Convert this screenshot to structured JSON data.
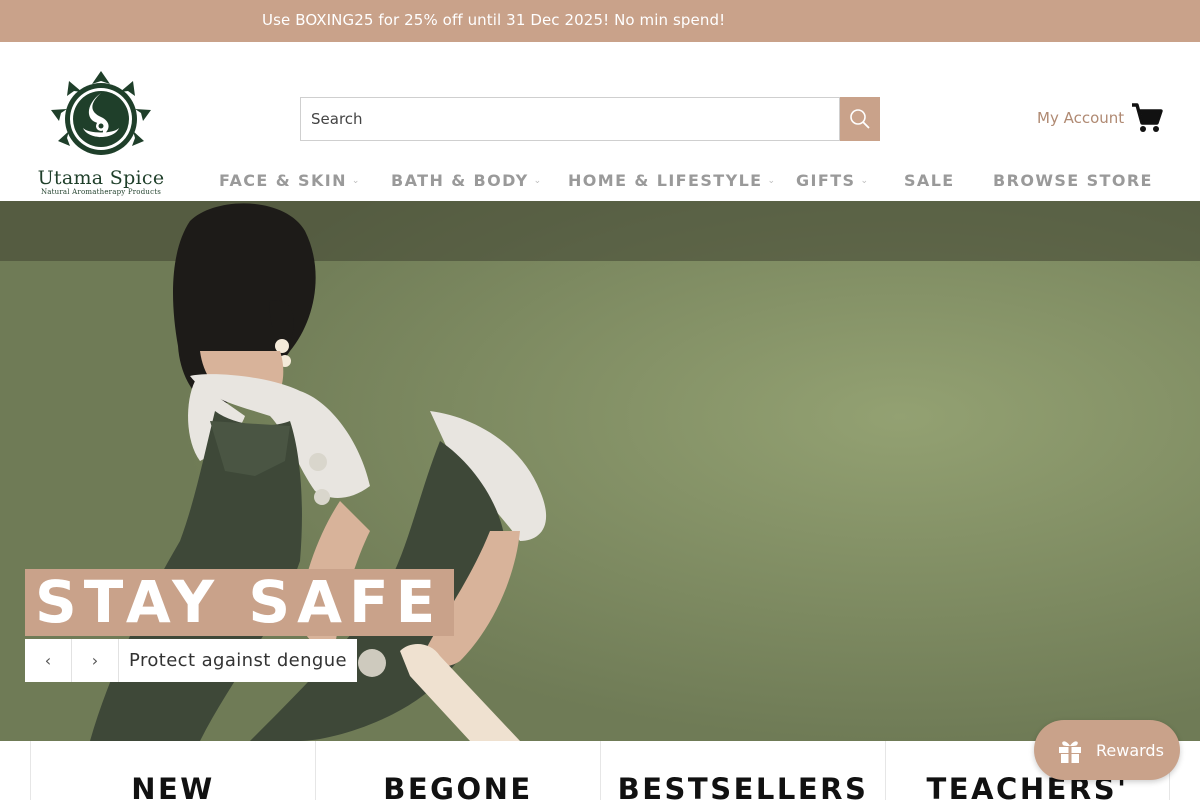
{
  "announcement": {
    "text": "Use BOXING25 for 25% off until 31 Dec 2025! No min spend!"
  },
  "brand": {
    "name": "Utama Spice",
    "tagline": "Natural Aromatherapy Products",
    "accent_color": "#c9a28a",
    "logo_color": "#1f3f2a"
  },
  "search": {
    "placeholder": "Search",
    "button_icon": "search-icon"
  },
  "account": {
    "label": "My Account",
    "cart_icon": "cart-icon"
  },
  "nav": {
    "items": [
      {
        "label": "FACE & SKIN",
        "has_dropdown": true
      },
      {
        "label": "BATH & BODY",
        "has_dropdown": true
      },
      {
        "label": "HOME & LIFESTYLE",
        "has_dropdown": true
      },
      {
        "label": "GIFTS",
        "has_dropdown": true
      },
      {
        "label": "SALE",
        "has_dropdown": false
      },
      {
        "label": "BROWSE STORE",
        "has_dropdown": false
      }
    ]
  },
  "hero": {
    "title": "STAY SAFE",
    "subtitle": "Protect against dengue",
    "prev_icon": "chevron-left-icon",
    "next_icon": "chevron-right-icon"
  },
  "collections": {
    "items": [
      {
        "label": "NEW"
      },
      {
        "label": "BEGONE"
      },
      {
        "label": "BESTSELLERS"
      },
      {
        "label": "TEACHERS'"
      }
    ]
  },
  "rewards": {
    "label": "Rewards",
    "icon": "gift-icon"
  }
}
